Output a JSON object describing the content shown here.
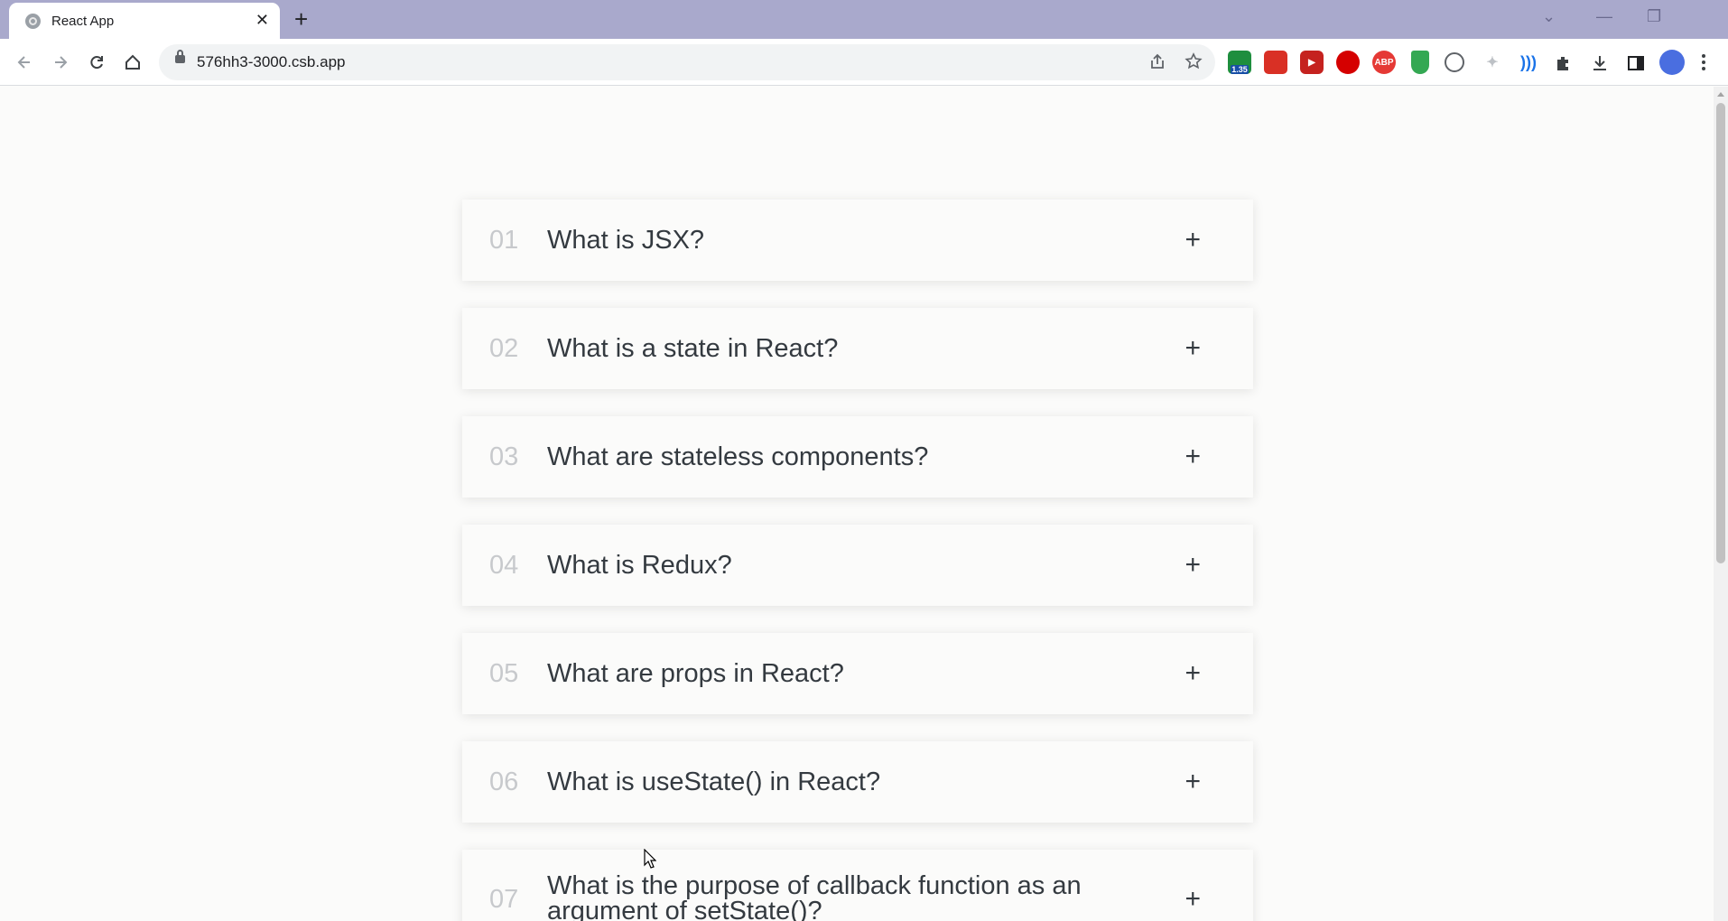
{
  "browser": {
    "tab_title": "React App",
    "tab_close": "✕",
    "new_tab": "+",
    "url": "576hh3-3000.csb.app",
    "window_controls": {
      "dropdown": "⌄",
      "minimize": "—",
      "restore": "❐"
    },
    "extension_badge": "1.35",
    "ext_abp": "ABP",
    "icons": [
      "back-icon",
      "forward-icon",
      "reload-icon",
      "home-icon",
      "lock-icon",
      "share-icon",
      "star-icon",
      "extensions-icon",
      "download-icon",
      "sidepanel-icon",
      "profile-icon",
      "menu-icon"
    ]
  },
  "faq": {
    "items": [
      {
        "num": "01",
        "question": "What is JSX?",
        "toggle": "+"
      },
      {
        "num": "02",
        "question": "What is a state in React?",
        "toggle": "+"
      },
      {
        "num": "03",
        "question": "What are stateless components?",
        "toggle": "+"
      },
      {
        "num": "04",
        "question": "What is Redux?",
        "toggle": "+"
      },
      {
        "num": "05",
        "question": "What are props in React?",
        "toggle": "+"
      },
      {
        "num": "06",
        "question": "What is useState() in React?",
        "toggle": "+"
      },
      {
        "num": "07",
        "question": "What is the purpose of callback function as an argument of setState()?",
        "toggle": "+"
      }
    ]
  }
}
